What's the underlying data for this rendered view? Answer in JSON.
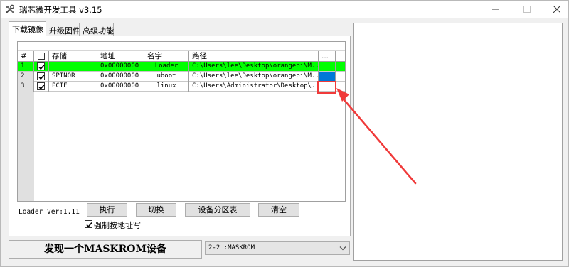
{
  "window": {
    "title": "瑞芯微开发工具 v3.15",
    "icons": {
      "app": "tools-icon",
      "minimize": "minimize-icon",
      "maximize": "maximize-icon",
      "close": "close-icon"
    }
  },
  "tabs": [
    {
      "label": "下载镜像",
      "active": true
    },
    {
      "label": "升级固件",
      "active": false
    },
    {
      "label": "高级功能",
      "active": false
    }
  ],
  "grid": {
    "columns": [
      "#",
      "",
      "存储",
      "地址",
      "名字",
      "路径",
      "..."
    ],
    "rows": [
      {
        "num": "1",
        "checked": true,
        "storage": "",
        "address": "0x00000000",
        "name": "Loader",
        "path": "C:\\Users\\lee\\Desktop\\orangepi\\M...",
        "highlight": true
      },
      {
        "num": "2",
        "checked": true,
        "storage": "SPINOR",
        "address": "0x00000000",
        "name": "uboot",
        "path": "C:\\Users\\lee\\Desktop\\orangepi\\M...",
        "highlight": false
      },
      {
        "num": "3",
        "checked": true,
        "storage": "PCIE",
        "address": "0x00000000",
        "name": "linux",
        "path": "C:\\Users\\Administrator\\Desktop\\...",
        "highlight": false
      }
    ]
  },
  "controls": {
    "loader_version": "Loader Ver:1.11",
    "execute": "执行",
    "switch": "切换",
    "partition": "设备分区表",
    "clear": "清空",
    "force_write_label": "强制按地址写",
    "force_write_checked": true
  },
  "status": {
    "message": "发现一个MASKROM设备",
    "device_select": "2-2 :MASKROM"
  },
  "colors": {
    "row_highlight": "#00ff00",
    "selected_cell": "#0078d7",
    "annotation": "#f03a3a"
  }
}
